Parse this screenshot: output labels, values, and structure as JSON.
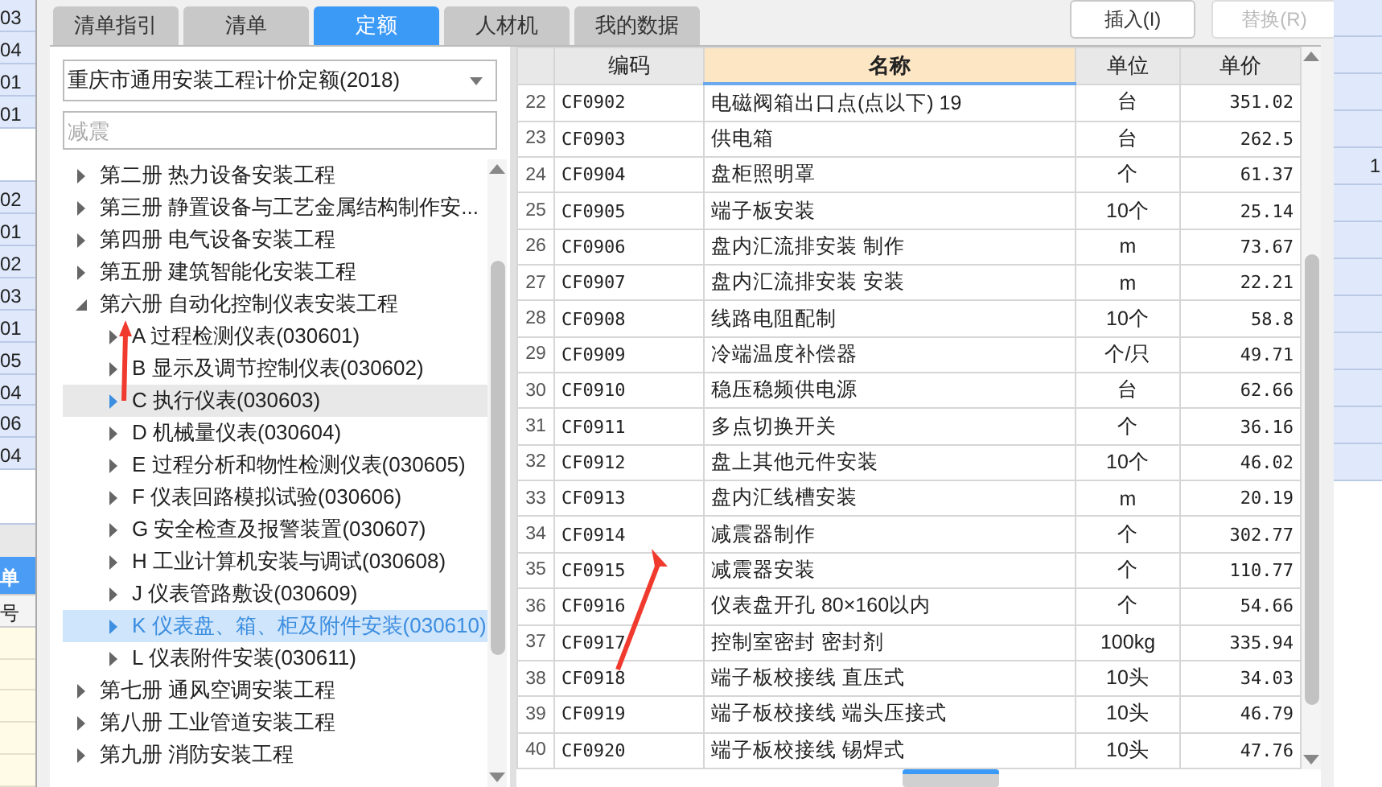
{
  "left_strip": {
    "cells": [
      "03",
      "04",
      "01",
      "01",
      "",
      "02",
      "01",
      "02",
      "03",
      "01",
      "05",
      "04",
      "06",
      "04",
      ""
    ],
    "header": "单",
    "subheader": "号"
  },
  "right_strip": {
    "cells": [
      "",
      "",
      "",
      "",
      "1",
      "",
      "",
      "",
      "",
      "",
      "",
      "",
      ""
    ]
  },
  "tabs": [
    {
      "label": "清单指引",
      "selected": false
    },
    {
      "label": "清单",
      "selected": false
    },
    {
      "label": "定额",
      "selected": true
    },
    {
      "label": "人材机",
      "selected": false
    },
    {
      "label": "我的数据",
      "selected": false
    }
  ],
  "buttons": [
    {
      "label": "插入(I)",
      "disabled": false
    },
    {
      "label": "替换(R)",
      "disabled": true
    }
  ],
  "dropdown": {
    "value": "重庆市通用安装工程计价定额(2018)"
  },
  "search": {
    "placeholder": "减震"
  },
  "tree": [
    {
      "label": "第二册 热力设备安装工程",
      "expanded": false,
      "selected": false,
      "hovered": false
    },
    {
      "label": "第三册 静置设备与工艺金属结构制作安...",
      "expanded": false,
      "selected": false,
      "hovered": false
    },
    {
      "label": "第四册 电气设备安装工程",
      "expanded": false,
      "selected": false,
      "hovered": false
    },
    {
      "label": "第五册 建筑智能化安装工程",
      "expanded": false,
      "selected": false,
      "hovered": false
    },
    {
      "label": "第六册 自动化控制仪表安装工程",
      "expanded": true,
      "selected": false,
      "hovered": false,
      "children": [
        {
          "label": "A 过程检测仪表(030601)",
          "expanded": false,
          "selected": false,
          "hovered": false
        },
        {
          "label": "B 显示及调节控制仪表(030602)",
          "expanded": false,
          "selected": false,
          "hovered": false
        },
        {
          "label": "C 执行仪表(030603)",
          "expanded": false,
          "selected": false,
          "hovered": true
        },
        {
          "label": "D 机械量仪表(030604)",
          "expanded": false,
          "selected": false,
          "hovered": false
        },
        {
          "label": "E 过程分析和物性检测仪表(030605)",
          "expanded": false,
          "selected": false,
          "hovered": false
        },
        {
          "label": "F 仪表回路模拟试验(030606)",
          "expanded": false,
          "selected": false,
          "hovered": false
        },
        {
          "label": "G 安全检查及报警装置(030607)",
          "expanded": false,
          "selected": false,
          "hovered": false
        },
        {
          "label": "H 工业计算机安装与调试(030608)",
          "expanded": false,
          "selected": false,
          "hovered": false
        },
        {
          "label": "J 仪表管路敷设(030609)",
          "expanded": false,
          "selected": false,
          "hovered": false
        },
        {
          "label": "K 仪表盘、箱、柜及附件安装(030610)",
          "expanded": false,
          "selected": true,
          "hovered": false
        },
        {
          "label": "L 仪表附件安装(030611)",
          "expanded": false,
          "selected": false,
          "hovered": false
        }
      ]
    },
    {
      "label": "第七册 通风空调安装工程",
      "expanded": false,
      "selected": false,
      "hovered": false
    },
    {
      "label": "第八册 工业管道安装工程",
      "expanded": false,
      "selected": false,
      "hovered": false
    },
    {
      "label": "第九册 消防安装工程",
      "expanded": false,
      "selected": false,
      "hovered": false
    }
  ],
  "table": {
    "columns": [
      {
        "selected": false
      },
      {
        "label": "编码",
        "selected": false
      },
      {
        "label": "名称",
        "selected": true
      },
      {
        "label": "单位",
        "selected": false
      },
      {
        "label": "单价",
        "selected": false
      }
    ],
    "rows": [
      [
        "22",
        "CF0902",
        "电磁阀箱出口点(点以下) 19",
        "台",
        "351.02"
      ],
      [
        "23",
        "CF0903",
        "供电箱",
        "台",
        "262.5"
      ],
      [
        "24",
        "CF0904",
        "盘柜照明罩",
        "个",
        "61.37"
      ],
      [
        "25",
        "CF0905",
        "端子板安装",
        "10个",
        "25.14"
      ],
      [
        "26",
        "CF0906",
        "盘内汇流排安装 制作",
        "m",
        "73.67"
      ],
      [
        "27",
        "CF0907",
        "盘内汇流排安装 安装",
        "m",
        "22.21"
      ],
      [
        "28",
        "CF0908",
        "线路电阻配制",
        "10个",
        "58.8"
      ],
      [
        "29",
        "CF0909",
        "冷端温度补偿器",
        "个/只",
        "49.71"
      ],
      [
        "30",
        "CF0910",
        "稳压稳频供电源",
        "台",
        "62.66"
      ],
      [
        "31",
        "CF0911",
        "多点切换开关",
        "个",
        "36.16"
      ],
      [
        "32",
        "CF0912",
        "盘上其他元件安装",
        "10个",
        "46.02"
      ],
      [
        "33",
        "CF0913",
        "盘内汇线槽安装",
        "m",
        "20.19"
      ],
      [
        "34",
        "CF0914",
        "减震器制作",
        "个",
        "302.77"
      ],
      [
        "35",
        "CF0915",
        "减震器安装",
        "个",
        "110.77"
      ],
      [
        "36",
        "CF0916",
        "仪表盘开孔 80×160以内",
        "个",
        "54.66"
      ],
      [
        "37",
        "CF0917",
        "控制室密封 密封剂",
        "100kg",
        "335.94"
      ],
      [
        "38",
        "CF0918",
        "端子板校接线 直压式",
        "10头",
        "34.03"
      ],
      [
        "39",
        "CF0919",
        "端子板校接线 端头压接式",
        "10头",
        "46.79"
      ],
      [
        "40",
        "CF0920",
        "端子板校接线 锡焊式",
        "10头",
        "47.76"
      ]
    ]
  },
  "annotations": [
    {
      "kind": "arrow"
    },
    {
      "kind": "arrow"
    }
  ]
}
